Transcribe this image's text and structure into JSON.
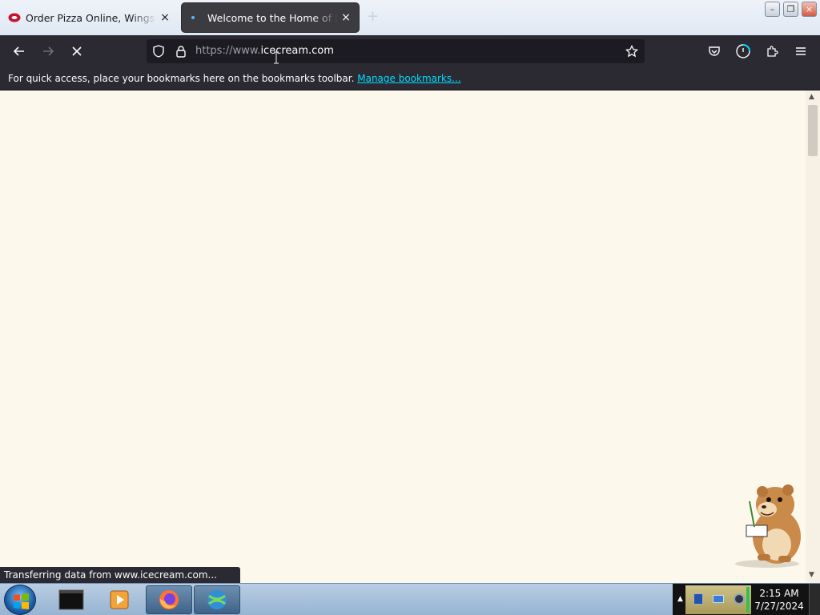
{
  "tabs": [
    {
      "title": "Order Pizza Online, Wings Delivery",
      "close": "×",
      "active": false
    },
    {
      "title": "Welcome to the Home of Ice Cream",
      "close": "×",
      "active": true
    }
  ],
  "newtab": "+",
  "window_controls": {
    "minimize": "–",
    "restore": "❐",
    "close": "×"
  },
  "nav": {
    "url_prefix": "https://www.",
    "url_domain": "icecream.com",
    "state": "loading"
  },
  "bookmarks_bar": {
    "message": "For quick access, place your bookmarks here on the bookmarks toolbar.",
    "link": "Manage bookmarks..."
  },
  "status_text": "Transferring data from www.icecream.com...",
  "taskbar": {
    "clock_time": "2:15 AM",
    "clock_date": "7/27/2024"
  },
  "colors": {
    "page_background": "#fdf8ec",
    "toolbar": "#2b2a33",
    "link": "#00ddff"
  }
}
